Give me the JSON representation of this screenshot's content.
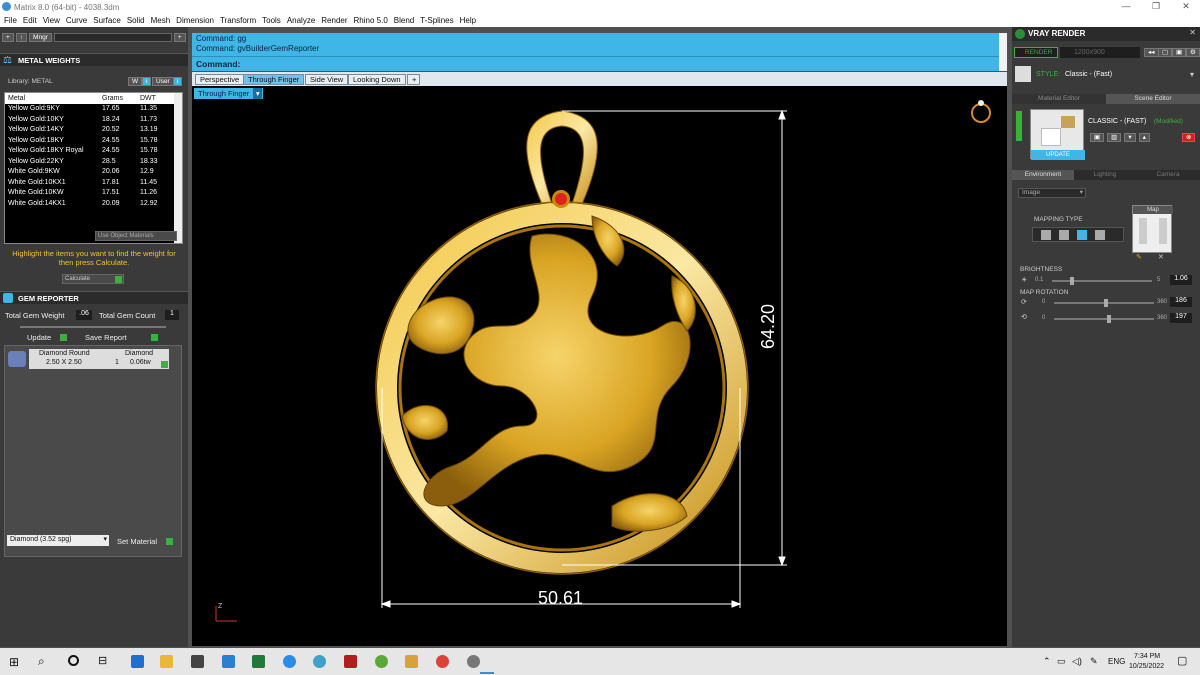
{
  "window": {
    "title": "Matrix 8.0 (64-bit) - 4038.3dm"
  },
  "menu": [
    "File",
    "Edit",
    "View",
    "Curve",
    "Surface",
    "Solid",
    "Mesh",
    "Dimension",
    "Transform",
    "Tools",
    "Analyze",
    "Render",
    "Rhino 5.0",
    "Blend",
    "T-Splines",
    "Help"
  ],
  "left_toolbar": {
    "mngr": "Mngr"
  },
  "metal_weights": {
    "title": "METAL WEIGHTS",
    "library_label": "Library: METAL",
    "btn_w": "W",
    "btn_user": "User",
    "columns": [
      "Metal",
      "Grams",
      "DWT"
    ],
    "rows": [
      [
        "Yellow Gold:9KY",
        "17.65",
        "11.35"
      ],
      [
        "Yellow Gold:10KY",
        "18.24",
        "11.73"
      ],
      [
        "Yellow Gold:14KY",
        "20.52",
        "13.19"
      ],
      [
        "Yellow Gold:18KY",
        "24.55",
        "15.78"
      ],
      [
        "Yellow Gold:18KY Royal",
        "24.55",
        "15.78"
      ],
      [
        "Yellow Gold:22KY",
        "28.5",
        "18.33"
      ],
      [
        "White Gold:9KW",
        "20.06",
        "12.9"
      ],
      [
        "White Gold:10KX1",
        "17.81",
        "11.45"
      ],
      [
        "White Gold:10KW",
        "17.51",
        "11.26"
      ],
      [
        "White Gold:14KX1",
        "20.09",
        "12.92"
      ]
    ],
    "use_object_materials": "Use Object Materials",
    "hint": "Highlight the items you want to find the weight for then press Calculate.",
    "calculate": "Calculate"
  },
  "gem_reporter": {
    "title": "GEM REPORTER",
    "total_weight_label": "Total Gem Weight",
    "total_weight": ".06",
    "total_count_label": "Total Gem Count",
    "total_count": "1",
    "update": "Update",
    "save_report": "Save Report",
    "gem": {
      "name": "Diamond Round",
      "material": "Diamond",
      "size": "2.50 X 2.50",
      "count": "1",
      "ctw": "0.06tw"
    },
    "material_select": "Diamond     (3.52 spg)",
    "set_material": "Set Material"
  },
  "command": {
    "line1": "Command: gg",
    "line2": "Command: gvBuilderGemReporter",
    "prompt": "Command:"
  },
  "view_tabs": [
    "Perspective",
    "Through Finger",
    "Side View",
    "Looking Down"
  ],
  "active_view": "Through Finger",
  "viewport_label": "Through Finger",
  "dimensions": {
    "height": "64.20",
    "width": "50.61"
  },
  "axis_label": "Z",
  "vray": {
    "title": "VRAY RENDER",
    "render": "RENDER",
    "resolution": "1200x900",
    "style_label": "STYLE:",
    "style_value": "Classic - (Fast)",
    "tabs": [
      "Material Editor",
      "Scene Editor"
    ],
    "preset_name": "CLASSIC - (FAST)",
    "modified": "(Modified)",
    "update": "UPDATE",
    "env_tabs": [
      "Environment",
      "Lighting",
      "Camera"
    ],
    "env_select": "Image",
    "mapping_type": "MAPPING TYPE",
    "map": "Map",
    "brightness_label": "BRIGHTNESS",
    "brightness_min": "0.1",
    "brightness_max": "5",
    "brightness": "1.06",
    "map_rotation_label": "MAP ROTATION",
    "rot1_min": "0",
    "rot1_max": "360",
    "rot1": "186",
    "rot2_min": "0",
    "rot2_max": "360",
    "rot2": "197"
  },
  "taskbar": {
    "lang": "ENG",
    "time": "7:34 PM",
    "date": "10/25/2022"
  }
}
